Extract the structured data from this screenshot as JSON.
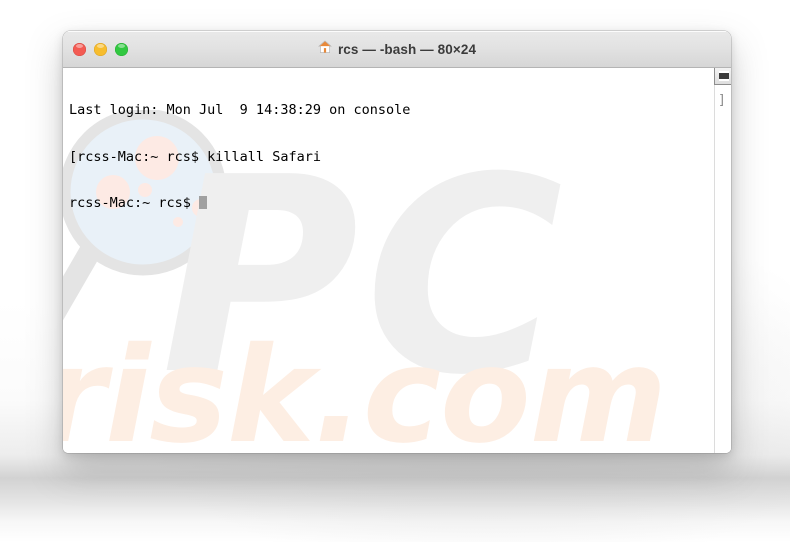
{
  "window": {
    "title": "rcs — -bash — 80×24",
    "title_icon": "home-icon",
    "traffic_lights": [
      {
        "name": "close",
        "color": "#f35b53"
      },
      {
        "name": "minimize",
        "color": "#f7bd2e"
      },
      {
        "name": "maximize",
        "color": "#31c840"
      }
    ]
  },
  "terminal": {
    "lines": [
      "Last login: Mon Jul  9 14:38:29 on console",
      "[rcss-Mac:~ rcs$ killall Safari",
      "rcss-Mac:~ rcs$ "
    ],
    "cursor": "block",
    "scroll_marker": "]",
    "corner_button": "scroll-corner-button"
  },
  "watermark": {
    "primary": "PC",
    "secondary": "risk.com",
    "logo": "magnifier-logo",
    "primary_color": "#efefef",
    "secondary_color": "#fdeee3"
  }
}
